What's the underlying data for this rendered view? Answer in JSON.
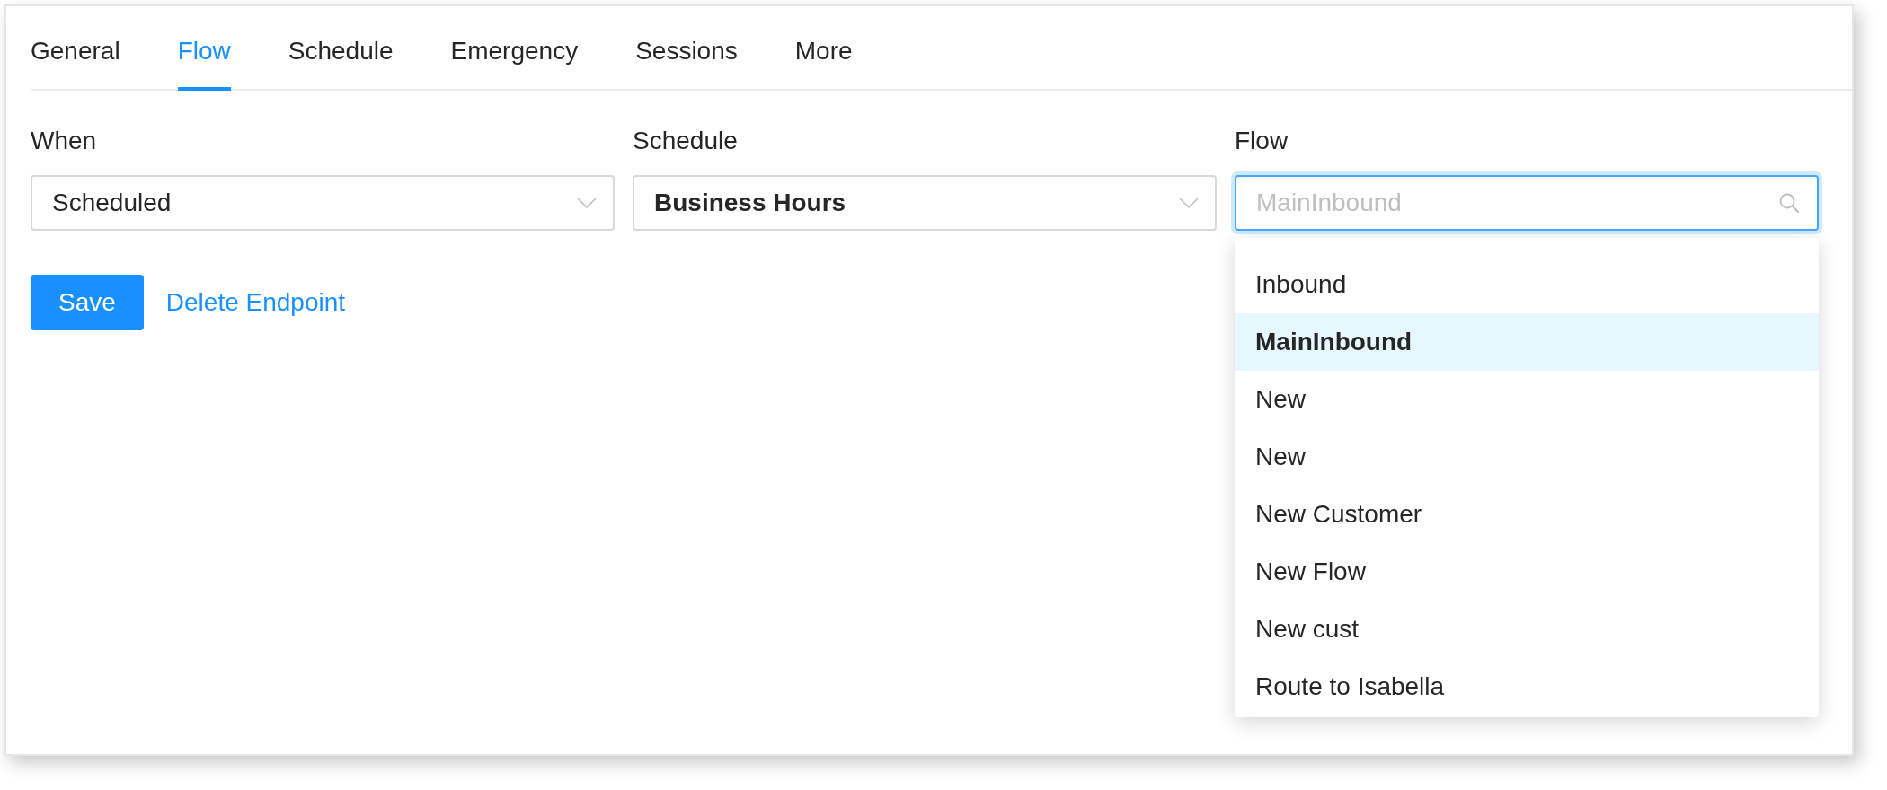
{
  "tabs": [
    {
      "label": "General",
      "selected": false
    },
    {
      "label": "Flow",
      "selected": true
    },
    {
      "label": "Schedule",
      "selected": false
    },
    {
      "label": "Emergency",
      "selected": false
    },
    {
      "label": "Sessions",
      "selected": false
    },
    {
      "label": "More",
      "selected": false
    }
  ],
  "form": {
    "fields": [
      {
        "kind": "select",
        "label": "When",
        "value": "Scheduled",
        "bold": false,
        "focused": false
      },
      {
        "kind": "select",
        "label": "Schedule",
        "value": "Business Hours",
        "bold": true,
        "focused": false
      },
      {
        "kind": "search",
        "label": "Flow",
        "placeholder": "MainInbound",
        "bold": false,
        "focused": true,
        "options": [
          {
            "label": "Inbound",
            "selected": false
          },
          {
            "label": "MainInbound",
            "selected": true
          },
          {
            "label": "New",
            "selected": false
          },
          {
            "label": "New",
            "selected": false
          },
          {
            "label": "New Customer",
            "selected": false
          },
          {
            "label": "New Flow",
            "selected": false
          },
          {
            "label": "New cust",
            "selected": false
          },
          {
            "label": "Route to Isabella",
            "selected": false
          }
        ]
      }
    ],
    "actions": [
      {
        "kind": "primary",
        "label": "Save"
      },
      {
        "kind": "link",
        "label": "Delete Endpoint"
      }
    ]
  }
}
